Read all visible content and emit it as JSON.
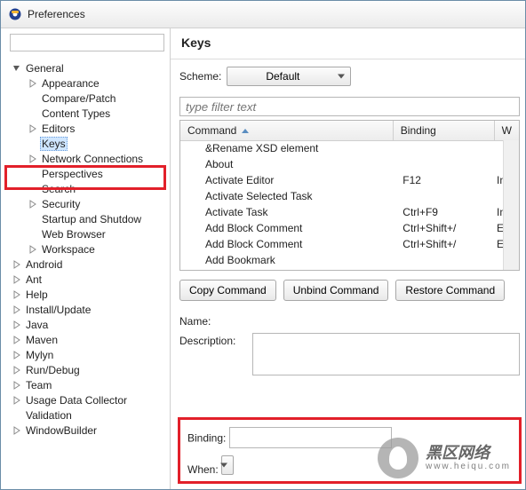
{
  "window": {
    "title": "Preferences"
  },
  "tree": {
    "items": [
      {
        "label": "General",
        "depth": 0,
        "expander": "open",
        "selected": false
      },
      {
        "label": "Appearance",
        "depth": 1,
        "expander": "closed",
        "selected": false
      },
      {
        "label": "Compare/Patch",
        "depth": 1,
        "expander": "none",
        "selected": false
      },
      {
        "label": "Content Types",
        "depth": 1,
        "expander": "none",
        "selected": false
      },
      {
        "label": "Editors",
        "depth": 1,
        "expander": "closed",
        "selected": false
      },
      {
        "label": "Keys",
        "depth": 1,
        "expander": "none",
        "selected": true
      },
      {
        "label": "Network Connections",
        "depth": 1,
        "expander": "closed",
        "selected": false
      },
      {
        "label": "Perspectives",
        "depth": 1,
        "expander": "none",
        "selected": false
      },
      {
        "label": "Search",
        "depth": 1,
        "expander": "none",
        "selected": false
      },
      {
        "label": "Security",
        "depth": 1,
        "expander": "closed",
        "selected": false
      },
      {
        "label": "Startup and Shutdow",
        "depth": 1,
        "expander": "none",
        "selected": false
      },
      {
        "label": "Web Browser",
        "depth": 1,
        "expander": "none",
        "selected": false
      },
      {
        "label": "Workspace",
        "depth": 1,
        "expander": "closed",
        "selected": false
      },
      {
        "label": "Android",
        "depth": 0,
        "expander": "closed",
        "selected": false
      },
      {
        "label": "Ant",
        "depth": 0,
        "expander": "closed",
        "selected": false
      },
      {
        "label": "Help",
        "depth": 0,
        "expander": "closed",
        "selected": false
      },
      {
        "label": "Install/Update",
        "depth": 0,
        "expander": "closed",
        "selected": false
      },
      {
        "label": "Java",
        "depth": 0,
        "expander": "closed",
        "selected": false
      },
      {
        "label": "Maven",
        "depth": 0,
        "expander": "closed",
        "selected": false
      },
      {
        "label": "Mylyn",
        "depth": 0,
        "expander": "closed",
        "selected": false
      },
      {
        "label": "Run/Debug",
        "depth": 0,
        "expander": "closed",
        "selected": false
      },
      {
        "label": "Team",
        "depth": 0,
        "expander": "closed",
        "selected": false
      },
      {
        "label": "Usage Data Collector",
        "depth": 0,
        "expander": "closed",
        "selected": false
      },
      {
        "label": "Validation",
        "depth": 0,
        "expander": "none",
        "selected": false
      },
      {
        "label": "WindowBuilder",
        "depth": 0,
        "expander": "closed",
        "selected": false
      }
    ]
  },
  "page": {
    "heading": "Keys",
    "scheme_label": "Scheme:",
    "scheme_value": "Default",
    "filter_placeholder": "type filter text",
    "columns": {
      "command": "Command",
      "binding": "Binding",
      "when": "W"
    },
    "rows": [
      {
        "command": "&Rename XSD element",
        "binding": "",
        "when": ""
      },
      {
        "command": "About",
        "binding": "",
        "when": ""
      },
      {
        "command": "Activate Editor",
        "binding": "F12",
        "when": "In"
      },
      {
        "command": "Activate Selected Task",
        "binding": "",
        "when": ""
      },
      {
        "command": "Activate Task",
        "binding": "Ctrl+F9",
        "when": "In"
      },
      {
        "command": "Add Block Comment",
        "binding": "Ctrl+Shift+/",
        "when": "Ed"
      },
      {
        "command": "Add Block Comment",
        "binding": "Ctrl+Shift+/",
        "when": "Ed"
      },
      {
        "command": "Add Bookmark",
        "binding": "",
        "when": ""
      }
    ],
    "buttons": {
      "copy": "Copy Command",
      "unbind": "Unbind Command",
      "restore": "Restore Command"
    },
    "form": {
      "name_label": "Name:",
      "description_label": "Description:",
      "binding_label": "Binding:",
      "when_label": "When:"
    }
  },
  "watermark": {
    "line1": "黑区网络",
    "domain": "www.heiqu.com"
  }
}
